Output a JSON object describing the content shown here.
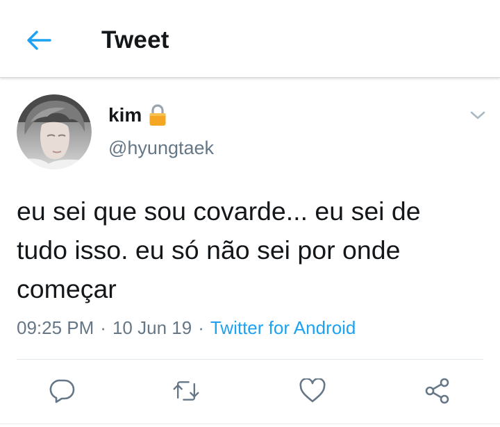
{
  "header": {
    "title": "Tweet",
    "back_icon": "arrow-left-icon"
  },
  "tweet": {
    "author": {
      "display_name": "kim",
      "username": "@hyungtaek",
      "protected_icon": "lock-icon"
    },
    "text": "eu sei que sou covarde... eu sei de\ntudo isso. eu só não sei por onde\ncomeçar",
    "time": "09:25 PM",
    "date": "10 Jun 19",
    "separator": "·",
    "source": "Twitter for Android"
  },
  "actions": [
    {
      "name": "reply",
      "icon": "reply-icon"
    },
    {
      "name": "retweet",
      "icon": "retweet-icon"
    },
    {
      "name": "like",
      "icon": "heart-icon"
    },
    {
      "name": "share",
      "icon": "share-icon"
    }
  ],
  "colors": {
    "accent": "#1da1f2",
    "text": "#14171a",
    "muted": "#657786",
    "icon": "#657786",
    "divider": "#e1e8ed",
    "lock": "#f5a623"
  }
}
